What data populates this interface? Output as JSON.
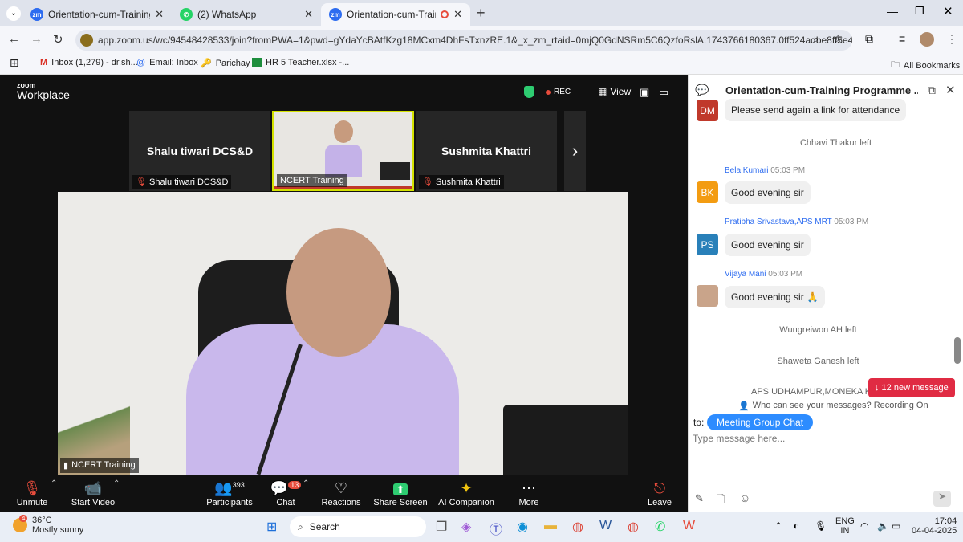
{
  "browser": {
    "tabs": [
      {
        "title": "Orientation-cum-Training Progr",
        "favicon": "zm"
      },
      {
        "title": "(2) WhatsApp",
        "favicon": "wa"
      },
      {
        "title": "Orientation-cum-Training P",
        "favicon": "zm"
      }
    ],
    "url": "app.zoom.us/wc/94548428533/join?fromPWA=1&pwd=gYdaYcBAtfKzg18MCxm4DhFsTxnzRE.1&_x_zm_rtaid=0mjQ0GdNSRm5C6QzfoRslA.1743766180367.0ff524adbe8ff5e46ca2640...",
    "bookmarks": [
      "Inbox (1,279) - dr.sh...",
      "Email: Inbox",
      "Parichay",
      "HR 5 Teacher.xlsx -..."
    ],
    "all_bookmarks": "All Bookmarks"
  },
  "zoom": {
    "logo_line1": "zoom",
    "logo_line2": "Workplace",
    "rec": "REC",
    "view": "View",
    "thumbs": [
      {
        "title": "Shalu tiwari DCS&D",
        "label": "Shalu tiwari DCS&D"
      },
      {
        "title": "",
        "label": "NCERT Training"
      },
      {
        "title": "Sushmita Khattri",
        "label": "Sushmita Khattri"
      }
    ],
    "speaker_label": "NCERT Training",
    "controls": [
      {
        "label": "Unmute",
        "icon": "mic-off-icon",
        "glyph": "🎙"
      },
      {
        "label": "Start Video",
        "icon": "video-off-icon",
        "glyph": "📹"
      },
      {
        "label": "Participants",
        "icon": "participants-icon",
        "glyph": "👥",
        "count": "393"
      },
      {
        "label": "Chat",
        "icon": "chat-icon",
        "glyph": "💬",
        "badge": "13"
      },
      {
        "label": "Reactions",
        "icon": "heart-icon",
        "glyph": "♡"
      },
      {
        "label": "Share Screen",
        "icon": "share-screen-icon",
        "glyph": "⬆"
      },
      {
        "label": "AI Companion",
        "icon": "sparkle-icon",
        "glyph": "✦"
      },
      {
        "label": "More",
        "icon": "more-icon",
        "glyph": "⋯"
      }
    ],
    "leave": "Leave"
  },
  "chat": {
    "title": "Orientation-cum-Training Programme ...",
    "first_msg": {
      "initials": "DM",
      "text": "Please send again a link for attendance",
      "color": "#c0392b"
    },
    "sys1": "Chhavi Thakur left",
    "messages": [
      {
        "name": "Bela Kumari",
        "time": "05:03 PM",
        "initials": "BK",
        "text": "Good evening sir",
        "color": "#f39c12"
      },
      {
        "name": "Pratibha Srivastava,APS MRT",
        "time": "05:03 PM",
        "initials": "PS",
        "text": "Good evening sir",
        "color": "#2980b9"
      },
      {
        "name": "Vijaya Mani",
        "time": "05:03 PM",
        "initials": "",
        "text": "Good evening sir 🙏",
        "color": "#c9a48a"
      }
    ],
    "sys2": "Wungreiwon AH left",
    "sys3": "Shaweta Ganesh left",
    "sys4": "APS UDHAMPUR,MONEKA KAU",
    "new_msgs": "↓ 12 new message",
    "privacy": "Who can see your messages? Recording On",
    "to": "to:",
    "recipient": "Meeting Group Chat",
    "placeholder": "Type message here..."
  },
  "taskbar": {
    "weather_badge": "4",
    "temp": "36°C",
    "weather": "Mostly sunny",
    "search": "Search",
    "lang1": "ENG",
    "lang2": "IN",
    "time": "17:04",
    "date": "04-04-2025"
  }
}
